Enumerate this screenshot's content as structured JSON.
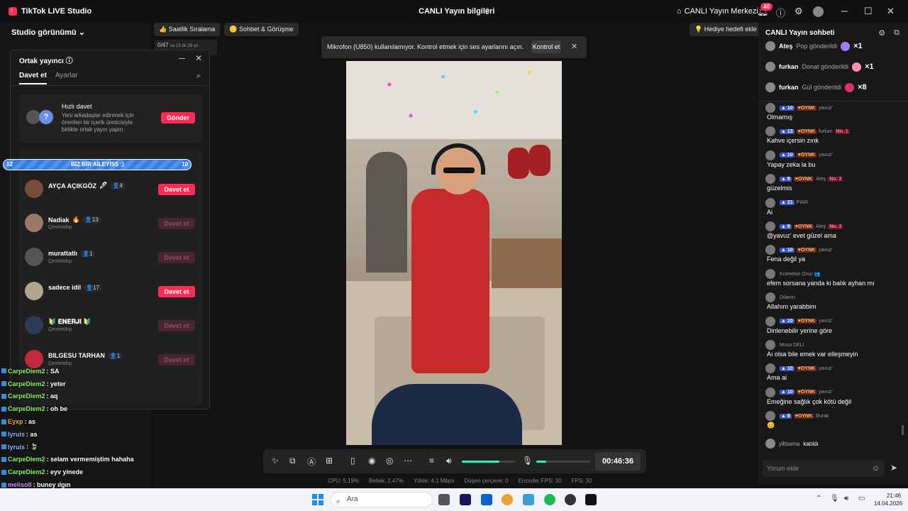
{
  "titlebar": {
    "app_name": "TikTok LIVE Studio",
    "center_title": "CANLI Yayın bilgileri",
    "live_center": "CANLI Yayın Merkezi",
    "notification_count": "40"
  },
  "toolbar": {
    "studio_view": "Studio görünümü",
    "chips": [
      "Saatlik Sıralama",
      "Sohbet & Görüşme"
    ],
    "gift_goal": "Hediye hedefi ekle",
    "mini_widget": "0/47",
    "mini_widget_sub": "sa 13 dk 28 sn"
  },
  "cohost": {
    "title": "Ortak yayıncı",
    "tabs": [
      "Davet et",
      "Ayarlar"
    ],
    "quick": {
      "title": "Hızlı davet",
      "desc": "Yeni arkadaşlar edinmek için önerilen bir içerik üreticisiyle birlikte ortak yayın yapın",
      "button": "Gönder"
    },
    "hosts": [
      {
        "name": "AYÇA AÇIKGÖZ",
        "badge": "🖊",
        "count": "4",
        "status": "",
        "button": "Davet et",
        "active": true,
        "color": "#7a4a3a"
      },
      {
        "name": "Nadiak",
        "badge": "🔥",
        "count": "13",
        "status": "Çevrimdışı",
        "button": "Davet et",
        "active": false,
        "color": "#9a7a66"
      },
      {
        "name": "murattatlı",
        "badge": "",
        "count": "1",
        "status": "Çevrimdışı",
        "button": "Davet et",
        "active": false,
        "color": "#555"
      },
      {
        "name": "sadece idil",
        "badge": "",
        "count": "17",
        "status": "",
        "button": "Davet et",
        "active": true,
        "color": "#b0a58f"
      },
      {
        "name": "🔰 𝐄𝐍𝐄𝐑𝐉𝐈 🔰",
        "badge": "",
        "count": "",
        "status": "Çevrimdışı",
        "button": "Davet et",
        "active": false,
        "color": "#2d3a55"
      },
      {
        "name": "BILGESU TARHAN",
        "badge": "",
        "count": "1",
        "status": "Çevrimdışı",
        "button": "Davet et",
        "active": false,
        "color": "#c02a3a"
      }
    ]
  },
  "progress_overlay": {
    "left": "12",
    "label": "BİZ BİR AİLEYİSS :)",
    "right": "10"
  },
  "overlay_chat": [
    {
      "user": "CarpeDiem2",
      "msg": ": SA",
      "color": "#8ef06a"
    },
    {
      "user": "CarpeDiem2",
      "msg": ": yeter",
      "color": "#8ef06a"
    },
    {
      "user": "CarpeDiem2",
      "msg": ": aq",
      "color": "#8ef06a"
    },
    {
      "user": "CarpeDiem2",
      "msg": ": oh be",
      "color": "#8ef06a"
    },
    {
      "user": "Eyxp",
      "msg": ": as",
      "color": "#f2a33a"
    },
    {
      "user": "lyruis",
      "msg": ": as",
      "color": "#8fb8ff"
    },
    {
      "user": "lyruis",
      "msg": ": 🍃",
      "color": "#8fb8ff"
    },
    {
      "user": "CarpeDiem2",
      "msg": ": selam vermemiştim hahaha",
      "color": "#8ef06a"
    },
    {
      "user": "CarpeDiem2",
      "msg": ": eyv yinede",
      "color": "#8ef06a"
    },
    {
      "user": "melisoll",
      "msg": ": buney ılgın",
      "color": "#d68cff"
    }
  ],
  "toast": {
    "text": "Mikrofon (U850) kullanılamıyor. Kontrol etmek için ses ayarlarını açın.",
    "button": "Kontrol et"
  },
  "controls": {
    "timer": "00:46:36",
    "volume_level": 0.7,
    "mic_level": 0.18
  },
  "stats": [
    "CPU: 5.19%",
    "Bellek: 2.47%",
    "Yükle: 4.1 Mbps",
    "Düşen çerçeve: 0",
    "Encoder FPS: 30",
    "FPS: 30"
  ],
  "chat": {
    "title": "CANLI Yayın sohbeti",
    "gifts": [
      {
        "user": "Ateş",
        "what": "Pop gönderildi",
        "count": "×1",
        "color": "#a77bff"
      },
      {
        "user": "furkan",
        "what": "Donat gönderildi",
        "count": "×1",
        "color": "#ff8fb3"
      },
      {
        "user": "furkan",
        "what": "Gül gönderildi",
        "count": "×8",
        "color": "#e0326a"
      }
    ],
    "messages": [
      {
        "level": "10",
        "fan": "OYNK",
        "user": "yavuz'",
        "rank": "",
        "text": "Olmamış"
      },
      {
        "level": "13",
        "fan": "OYNK",
        "user": "furkan",
        "rank": "No. 1",
        "text": "Kahve içersin zınk"
      },
      {
        "level": "10",
        "fan": "OYNK",
        "user": "yavuz'",
        "rank": "",
        "text": "Yapay zeka la bu"
      },
      {
        "level": "9",
        "fan": "OYNK",
        "user": "Ateş",
        "rank": "No. 3",
        "text": "güzelmis"
      },
      {
        "level": "21",
        "fan": "",
        "user": "PIAR",
        "rank": "",
        "text": "Ai"
      },
      {
        "level": "9",
        "fan": "OYNK",
        "user": "Ateş",
        "rank": "No. 3",
        "text": "@yavuz' evet güzel ama"
      },
      {
        "level": "10",
        "fan": "OYNK",
        "user": "yavuz'",
        "rank": "",
        "text": "Fena değil ya"
      },
      {
        "level": "",
        "fan": "",
        "user": "Kısmetse Onur 👥",
        "rank": "",
        "text": "efem sorsana yanda ki balık ayhan mı"
      },
      {
        "level": "",
        "fan": "",
        "user": "Dilanın",
        "rank": "",
        "text": "Allahım yarabbim"
      },
      {
        "level": "10",
        "fan": "OYNK",
        "user": "yavuz'",
        "rank": "",
        "text": "Dinlenebilir yerine göre"
      },
      {
        "level": "",
        "fan": "",
        "user": "Musa DELİ",
        "rank": "",
        "text": "Aı olsa bile emek var elleşmeyin"
      },
      {
        "level": "10",
        "fan": "OYNK",
        "user": "yavuz'",
        "rank": "",
        "text": "Ama ai"
      },
      {
        "level": "10",
        "fan": "OYNK",
        "user": "yavuz'",
        "rank": "",
        "text": "Emeğine sağlık çok kötü değil"
      },
      {
        "level": "8",
        "fan": "OYNK",
        "user": "Burak",
        "rank": "",
        "text": "😊"
      }
    ],
    "joined_user": "yiltsama",
    "joined_text": "katıldı",
    "comment_placeholder": "Yorum ekle"
  },
  "taskbar": {
    "search": "Ara",
    "time": "21:46",
    "date": "14.04.2026"
  }
}
